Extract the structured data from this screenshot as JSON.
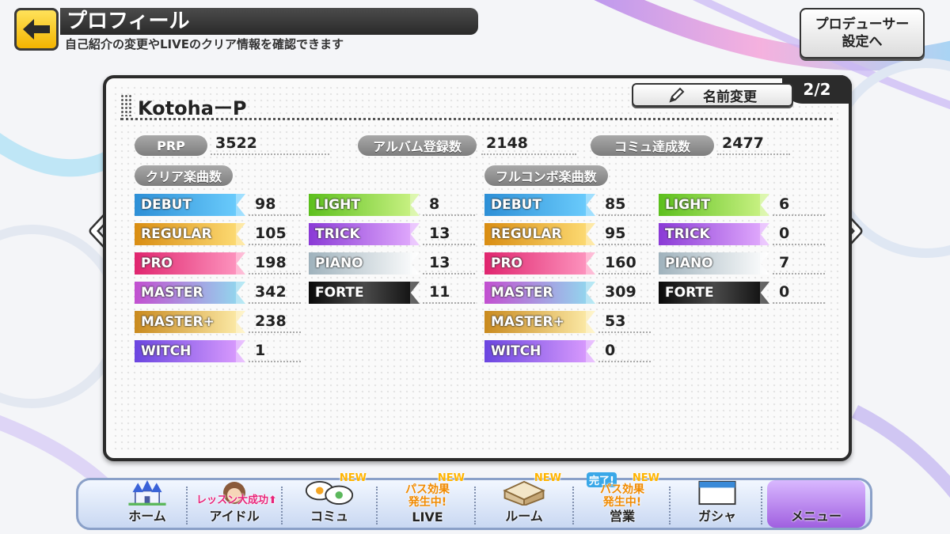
{
  "header": {
    "title": "プロフィール",
    "subtitle": "自己紹介の変更やLIVEのクリア情報を確認できます",
    "producer_settings_label": "プロデューサー\n設定へ"
  },
  "profile": {
    "page_indicator": "2/2",
    "rename_label": "名前変更",
    "name": "KotohaーP",
    "stats": [
      {
        "label": "PRP",
        "value": "3522"
      },
      {
        "label": "アルバム登録数",
        "value": "2148"
      },
      {
        "label": "コミュ達成数",
        "value": "2477"
      }
    ]
  },
  "clear": {
    "title": "クリア楽曲数",
    "left": [
      {
        "label": "DEBUT",
        "count": "98"
      },
      {
        "label": "REGULAR",
        "count": "105"
      },
      {
        "label": "PRO",
        "count": "198"
      },
      {
        "label": "MASTER",
        "count": "342"
      },
      {
        "label": "MASTER+",
        "count": "238"
      },
      {
        "label": "WITCH",
        "count": "1"
      }
    ],
    "right": [
      {
        "label": "LIGHT",
        "count": "8"
      },
      {
        "label": "TRICK",
        "count": "13"
      },
      {
        "label": "PIANO",
        "count": "13"
      },
      {
        "label": "FORTE",
        "count": "11"
      }
    ]
  },
  "full_combo": {
    "title": "フルコンボ楽曲数",
    "left": [
      {
        "label": "DEBUT",
        "count": "85"
      },
      {
        "label": "REGULAR",
        "count": "95"
      },
      {
        "label": "PRO",
        "count": "160"
      },
      {
        "label": "MASTER",
        "count": "309"
      },
      {
        "label": "MASTER+",
        "count": "53"
      },
      {
        "label": "WITCH",
        "count": "0"
      }
    ],
    "right": [
      {
        "label": "LIGHT",
        "count": "6"
      },
      {
        "label": "TRICK",
        "count": "0"
      },
      {
        "label": "PIANO",
        "count": "7"
      },
      {
        "label": "FORTE",
        "count": "0"
      }
    ]
  },
  "menu": {
    "items": [
      {
        "label": "ホーム"
      },
      {
        "label": "アイドル",
        "promo": "レッスン大成功⬆"
      },
      {
        "label": "コミュ",
        "badge": "NEW"
      },
      {
        "label": "LIVE",
        "badge": "NEW",
        "promo": "パス効果\n発生中!"
      },
      {
        "label": "ルーム",
        "badge": "NEW"
      },
      {
        "label": "営業",
        "badge": "NEW",
        "done": "完了!",
        "promo": "パス効果\n発生中!"
      },
      {
        "label": "ガシャ"
      },
      {
        "label": "メニュー"
      }
    ]
  },
  "colors": {
    "DEBUT": "#3fa9e6",
    "REGULAR": "#e8a71e",
    "PRO": "#e83a7e",
    "MASTER": "#b35ad6",
    "MASTER+": "#d9a13a",
    "WITCH": "#7a5ae0",
    "LIGHT": "#7ccf2e",
    "TRICK": "#9c4fe0",
    "PIANO": "#c2cfd6",
    "FORTE": "#1a1a1a"
  },
  "icons": [
    "back-arrow-icon",
    "pencil-icon",
    "chevron-left-icon",
    "chevron-right-icon",
    "castle-icon",
    "idol-avatar-icon",
    "speech-bubbles-icon",
    "room-icon",
    "gacha-icon"
  ]
}
